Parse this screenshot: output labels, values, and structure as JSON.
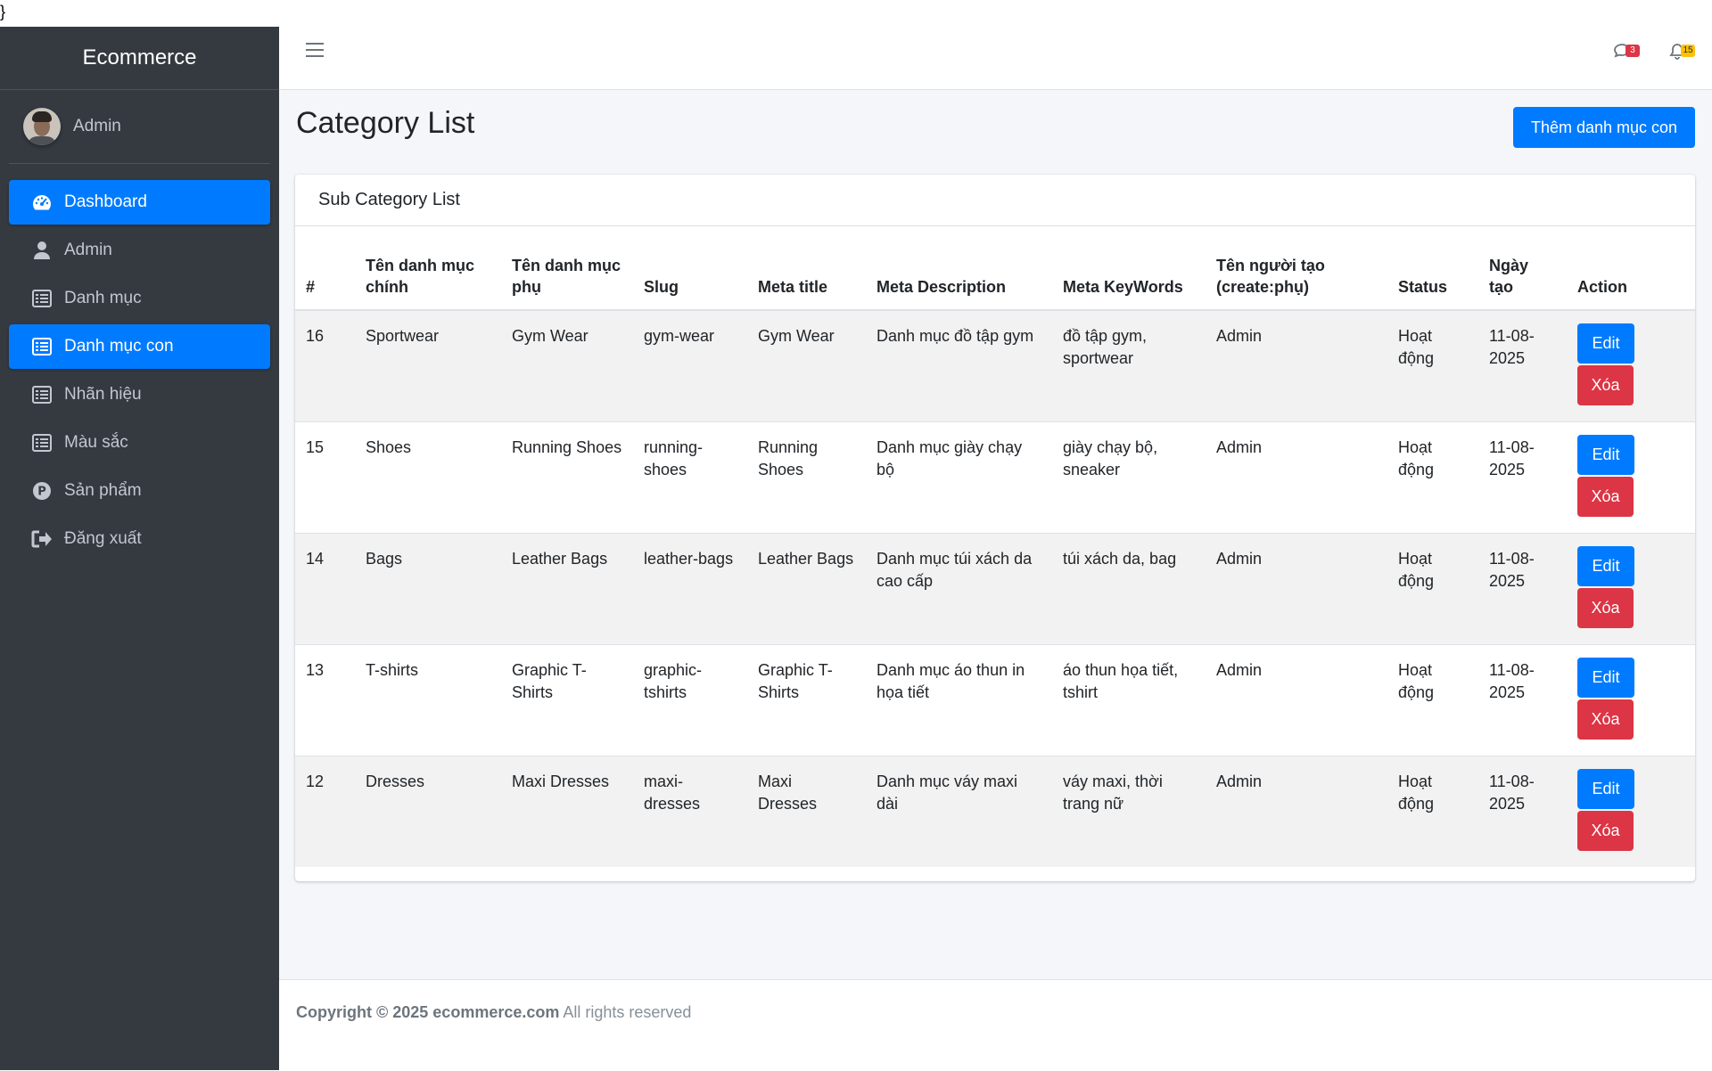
{
  "stray_char": "}",
  "brand": "Ecommerce",
  "user": {
    "name": "Admin"
  },
  "sidebar": {
    "items": [
      {
        "label": "Dashboard",
        "icon": "dashboard-gauge-icon",
        "active": true
      },
      {
        "label": "Admin",
        "icon": "user-icon",
        "active": false
      },
      {
        "label": "Danh mục",
        "icon": "list-icon",
        "active": false
      },
      {
        "label": "Danh mục con",
        "icon": "list-icon",
        "active": true
      },
      {
        "label": "Nhãn hiệu",
        "icon": "list-icon",
        "active": false
      },
      {
        "label": "Màu sắc",
        "icon": "list-icon",
        "active": false
      },
      {
        "label": "Sản phẩm",
        "icon": "product-p-icon",
        "active": false
      },
      {
        "label": "Đăng xuất",
        "icon": "sign-out-icon",
        "active": false
      }
    ]
  },
  "topbar": {
    "menu_icon": "hamburger-icon",
    "messages_badge": "3",
    "notifications_badge": "15"
  },
  "page": {
    "title": "Category List",
    "add_button": "Thêm danh mục con"
  },
  "card": {
    "header": "Sub Category List",
    "columns": [
      "#",
      "Tên danh mục chính",
      "Tên danh mục phụ",
      "Slug",
      "Meta title",
      "Meta Description",
      "Meta KeyWords",
      "Tên người tạo (create:phụ)",
      "Status",
      "Ngày tạo",
      "Action"
    ],
    "rows": [
      {
        "id": "16",
        "main": "Sportwear",
        "sub": "Gym Wear",
        "slug": "gym-wear",
        "meta_title": "Gym Wear",
        "meta_desc": "Danh mục đồ tập gym",
        "keywords": "đồ tập gym, sportwear",
        "creator": "Admin",
        "status": "Hoạt động",
        "date": "11-08-2025",
        "edit": "Edit",
        "delete": "Xóa"
      },
      {
        "id": "15",
        "main": "Shoes",
        "sub": "Running Shoes",
        "slug": "running-shoes",
        "meta_title": "Running Shoes",
        "meta_desc": "Danh mục giày chạy bộ",
        "keywords": "giày chạy bộ, sneaker",
        "creator": "Admin",
        "status": "Hoạt động",
        "date": "11-08-2025",
        "edit": "Edit",
        "delete": "Xóa"
      },
      {
        "id": "14",
        "main": "Bags",
        "sub": "Leather Bags",
        "slug": "leather-bags",
        "meta_title": "Leather Bags",
        "meta_desc": "Danh mục túi xách da cao cấp",
        "keywords": "túi xách da, bag",
        "creator": "Admin",
        "status": "Hoạt động",
        "date": "11-08-2025",
        "edit": "Edit",
        "delete": "Xóa"
      },
      {
        "id": "13",
        "main": "T-shirts",
        "sub": "Graphic T-Shirts",
        "slug": "graphic-tshirts",
        "meta_title": "Graphic T-Shirts",
        "meta_desc": "Danh mục áo thun in họa tiết",
        "keywords": "áo thun họa tiết, tshirt",
        "creator": "Admin",
        "status": "Hoạt động",
        "date": "11-08-2025",
        "edit": "Edit",
        "delete": "Xóa"
      },
      {
        "id": "12",
        "main": "Dresses",
        "sub": "Maxi Dresses",
        "slug": "maxi-dresses",
        "meta_title": "Maxi Dresses",
        "meta_desc": "Danh mục váy maxi dài",
        "keywords": "váy maxi, thời trang nữ",
        "creator": "Admin",
        "status": "Hoạt động",
        "date": "11-08-2025",
        "edit": "Edit",
        "delete": "Xóa"
      }
    ]
  },
  "footer": {
    "copyright": "Copyright © 2025 ecommerce.com",
    "rights": "All rights reserved"
  },
  "colors": {
    "sidebar_bg": "#343a40",
    "primary": "#007bff",
    "danger": "#dc3545",
    "warning": "#ffc107",
    "content_bg": "#f4f6f9"
  }
}
